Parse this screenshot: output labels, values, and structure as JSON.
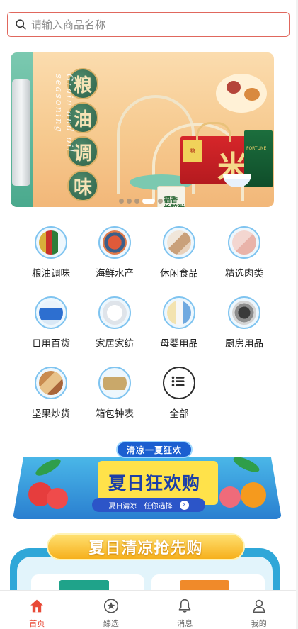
{
  "search": {
    "placeholder": "请输入商品名称",
    "icon": "search-icon"
  },
  "banner": {
    "seal_chars": [
      "粮",
      "油",
      "调",
      "味"
    ],
    "vertical_text": "Grain and oil seasoning",
    "rice_bag_label": "福香 长粒米",
    "gift_box_char": "米",
    "green_bag_label": "FORTUNE",
    "slide_count": 5,
    "active_slide": 3
  },
  "categories": [
    {
      "label": "粮油调味",
      "icon": "cooking-oil-icon"
    },
    {
      "label": "海鲜水产",
      "icon": "seafood-icon"
    },
    {
      "label": "休闲食品",
      "icon": "snacks-icon"
    },
    {
      "label": "精选肉类",
      "icon": "meat-icon"
    },
    {
      "label": "日用百货",
      "icon": "daily-goods-icon"
    },
    {
      "label": "家居家纺",
      "icon": "home-textile-icon"
    },
    {
      "label": "母婴用品",
      "icon": "baby-products-icon"
    },
    {
      "label": "厨房用品",
      "icon": "kitchen-cooker-icon"
    },
    {
      "label": "坚果炒货",
      "icon": "nuts-icon"
    },
    {
      "label": "箱包钟表",
      "icon": "luggage-icon"
    },
    {
      "label": "全部",
      "icon": "list-menu-icon"
    }
  ],
  "promo": {
    "ribbon": "清凉一夏狂欢",
    "title": "夏日狂欢购",
    "pill_left": "夏日清凉",
    "pill_right": "任你选择"
  },
  "section2": {
    "title": "夏日清凉抢先购"
  },
  "tabbar": [
    {
      "label": "首页",
      "icon": "home-icon",
      "active": true
    },
    {
      "label": "臻选",
      "icon": "star-circle-icon",
      "active": false
    },
    {
      "label": "消息",
      "icon": "bell-icon",
      "active": false
    },
    {
      "label": "我的",
      "icon": "user-icon",
      "active": false
    }
  ],
  "colors": {
    "accent": "#e84a37",
    "search_border": "#e0675d",
    "icon_ring": "#7fc4f0"
  }
}
